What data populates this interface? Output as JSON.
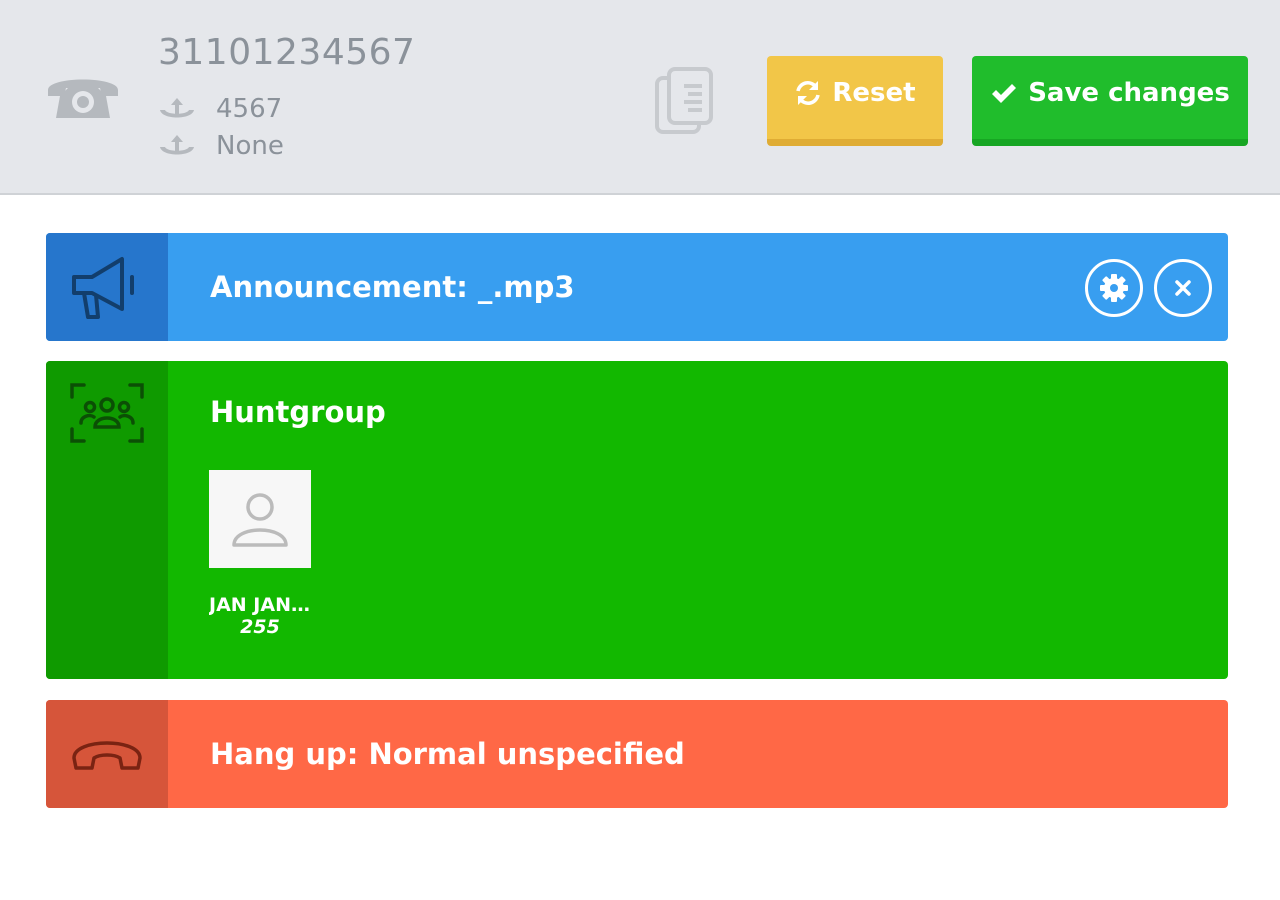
{
  "header": {
    "number": "31101234567",
    "extension": "4567",
    "secondary": "None",
    "reset_label": "Reset",
    "save_label": "Save changes"
  },
  "blocks": {
    "announcement": {
      "title": "Announcement: _.mp3"
    },
    "huntgroup": {
      "title": "Huntgroup",
      "members": [
        {
          "name": "JAN JAN...",
          "extension": "255"
        }
      ]
    },
    "hangup": {
      "title": "Hang up: Normal unspecified"
    }
  },
  "colors": {
    "announcement": "#389ef0",
    "huntgroup": "#12b800",
    "hangup": "#ff6846",
    "reset": "#f2c648",
    "save": "#20bd2c"
  },
  "icons": [
    "phone-icon",
    "anchor-icon",
    "copy-icon",
    "refresh-icon",
    "check-icon",
    "megaphone-icon",
    "gear-icon",
    "close-icon",
    "group-icon",
    "user-icon",
    "hangup-icon"
  ]
}
